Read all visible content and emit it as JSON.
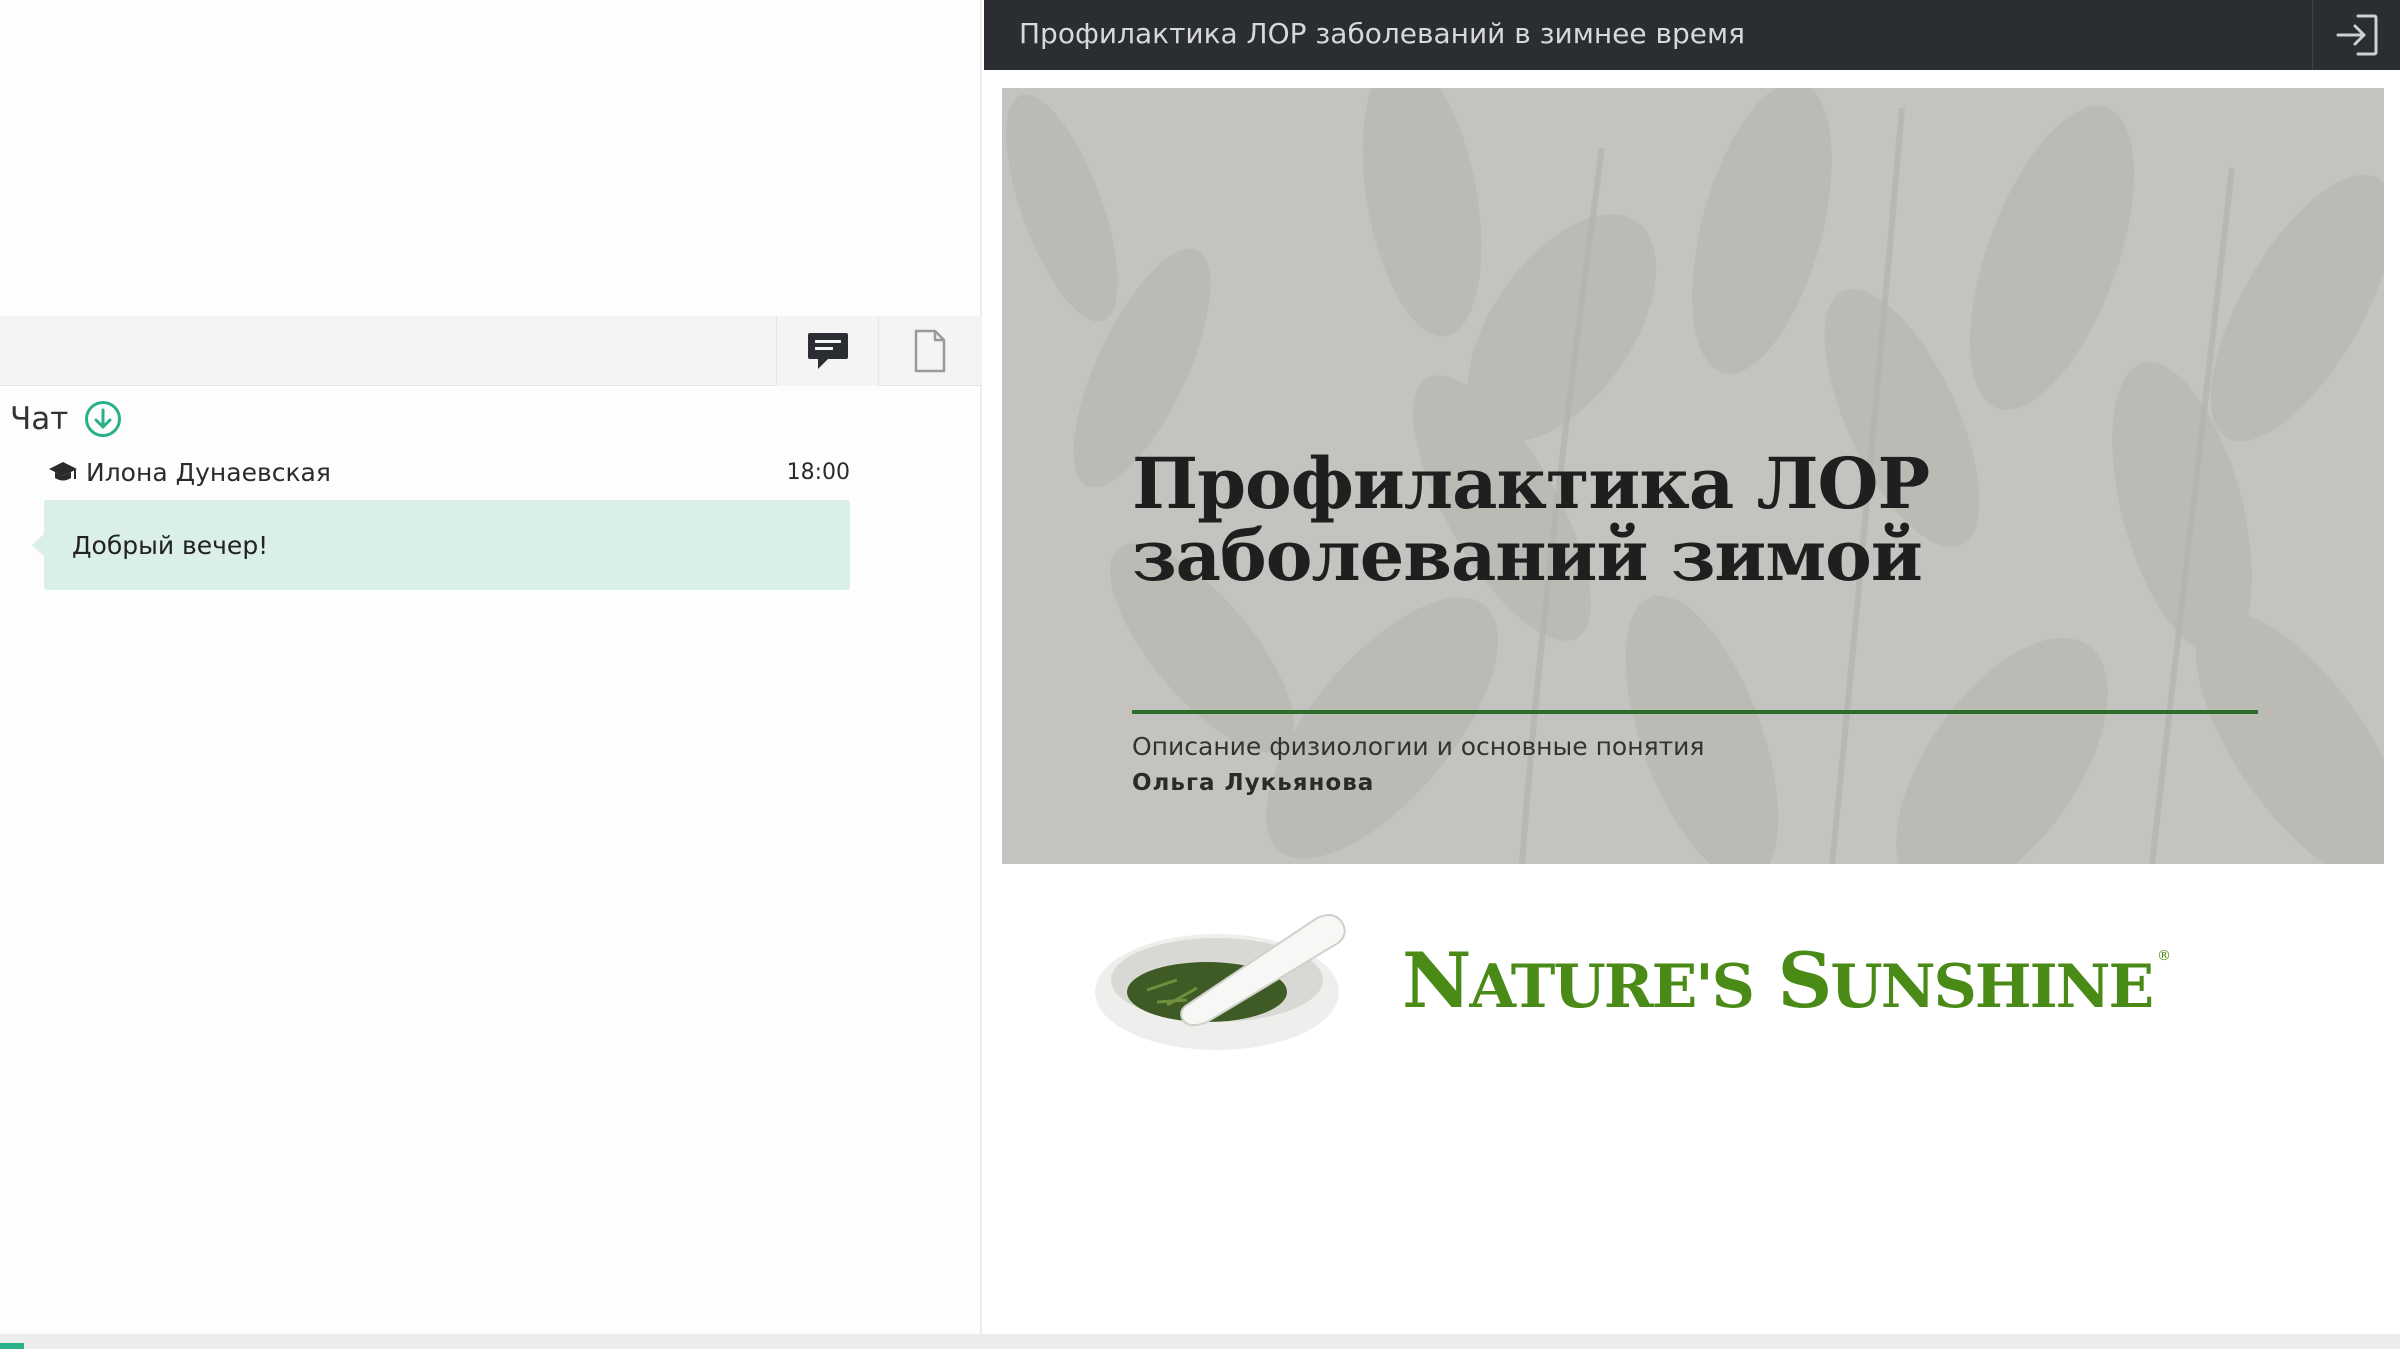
{
  "header": {
    "presentation_title": "Профилактика ЛОР заболеваний в зимнее время",
    "exit_icon": "sign-in-icon"
  },
  "tabs": [
    {
      "name": "chat",
      "icon": "chat-bubble-icon",
      "active": true
    },
    {
      "name": "files",
      "icon": "file-icon",
      "active": false
    }
  ],
  "chat": {
    "title": "Чат",
    "scroll_icon": "arrow-down-circle-icon",
    "accent_color": "#2bb08a",
    "messages": [
      {
        "author": "Илона Дунаевская",
        "author_icon": "graduation-cap-icon",
        "time": "18:00",
        "text": "Добрый вечер!"
      }
    ]
  },
  "slide": {
    "title_line1": "Профилактика ЛОР",
    "title_line2": "заболеваний зимой",
    "subtitle": "Описание физиологии и основные понятия",
    "author": "Ольга Лукьянова",
    "rule_color": "#2f6b2b"
  },
  "logo": {
    "brand_part1_initial": "N",
    "brand_part1_rest": "ATURE'S",
    "brand_part2_initial": "S",
    "brand_part2_rest": "UNSHINE",
    "registered": "®",
    "brand_color": "#4a8a16"
  }
}
